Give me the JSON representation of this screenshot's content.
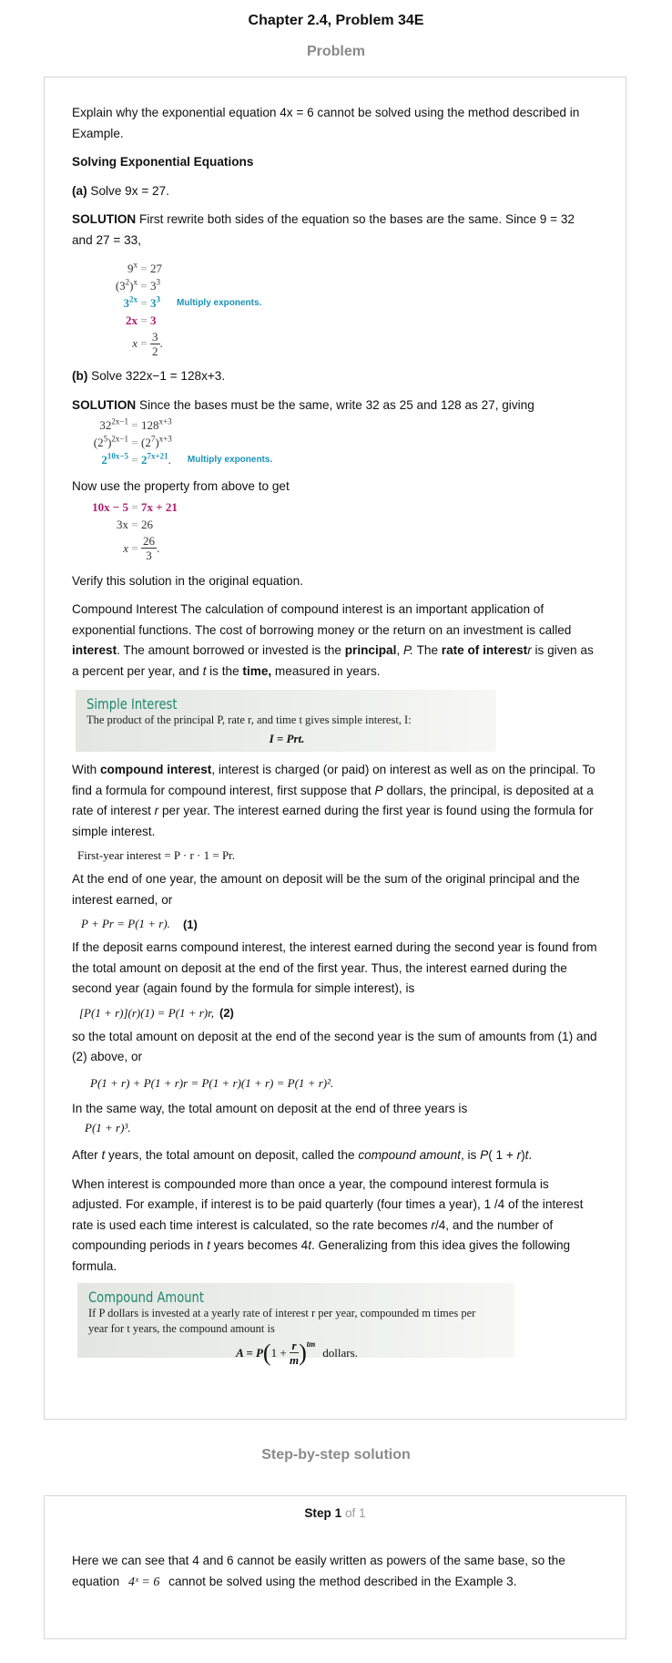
{
  "header": {
    "title": "Chapter 2.4, Problem 34E",
    "problem_label": "Problem",
    "solution_label": "Step-by-step solution"
  },
  "problem": {
    "intro": "Explain why the exponential equation 4x = 6 cannot be solved using the method described in Example.",
    "heading": "Solving Exponential Equations",
    "part_a_tag": "(a)",
    "part_a_text": "Solve 9x = 27.",
    "solution_tag": "SOLUTION",
    "part_a_solution": "First rewrite both sides of the equation so the bases are the same. Since 9 = 32 and 27 = 33,",
    "part_a_note": "Multiply exponents.",
    "part_b_tag": "(b)",
    "part_b_text": "Solve 322x−1 = 128x+3.",
    "part_b_solution": "Since the bases must be the same, write 32 as 25 and 128 as 27, giving",
    "part_b_note": "Multiply exponents.",
    "property_text": "Now use the property from above to get",
    "verify_text": "Verify this solution in the original equation.",
    "simple_interest_card": {
      "title": "Simple Interest",
      "text": "The product of the principal P, rate r, and time t gives simple interest, I:",
      "formula": "I = Prt."
    },
    "first_year_eq": "First-year interest = P · r · 1 = Pr.",
    "eq1": "P + Pr = P(1 + r).",
    "eq1_tag": "(1)",
    "eq2": "[P(1 + r)](r)(1) = P(1 + r)r,",
    "eq2_tag": "(2)",
    "eq3": "P(1 + r) + P(1 + r)r = P(1 + r)(1 + r) = P(1 + r)².",
    "eq4": "P(1 + r)³.",
    "compound_card": {
      "title": "Compound Amount",
      "text1": "If P dollars is invested at a yearly rate of interest r per year, compounded m times per",
      "text2": "year for t years, the compound amount is",
      "formula_left": "A = P",
      "formula_right": "dollars."
    }
  },
  "solution": {
    "step_word": "Step 1",
    "step_of": "of 1",
    "text_before": "Here we can see that 4 and 6 cannot be easily written as powers of the same base, so the equation",
    "equation": "4ˣ = 6",
    "text_after": "cannot be solved using the method described in the Example 3."
  }
}
